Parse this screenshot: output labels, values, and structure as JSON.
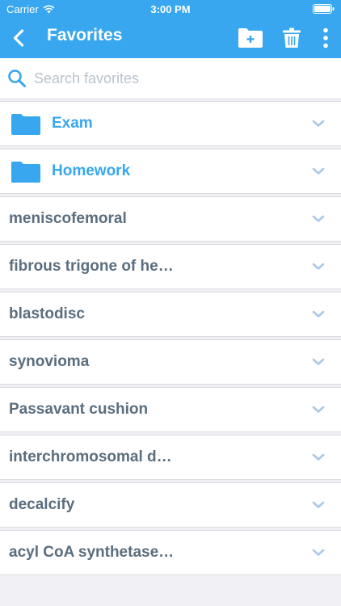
{
  "status_bar": {
    "carrier": "Carrier",
    "time": "3:00 PM"
  },
  "nav": {
    "title": "Favorites",
    "icons": [
      "back-chevron-icon",
      "new-folder-icon",
      "trash-icon",
      "more-vertical-icon"
    ]
  },
  "search": {
    "placeholder": "Search favorites",
    "value": ""
  },
  "folders": [
    {
      "label": "Exam",
      "icon": "folder-icon"
    },
    {
      "label": "Homework",
      "icon": "folder-icon"
    }
  ],
  "items": [
    {
      "label": "meniscofemoral"
    },
    {
      "label": "fibrous trigone of he…"
    },
    {
      "label": "blastodisc"
    },
    {
      "label": "synovioma"
    },
    {
      "label": "Passavant cushion"
    },
    {
      "label": "interchromosomal d…"
    },
    {
      "label": "decalcify"
    },
    {
      "label": "acyl CoA synthetase…"
    }
  ],
  "colors": {
    "accent": "#38a7ef",
    "item_text": "#5a6e7e",
    "chevron": "#a9c9e6",
    "background": "#efeff4"
  }
}
